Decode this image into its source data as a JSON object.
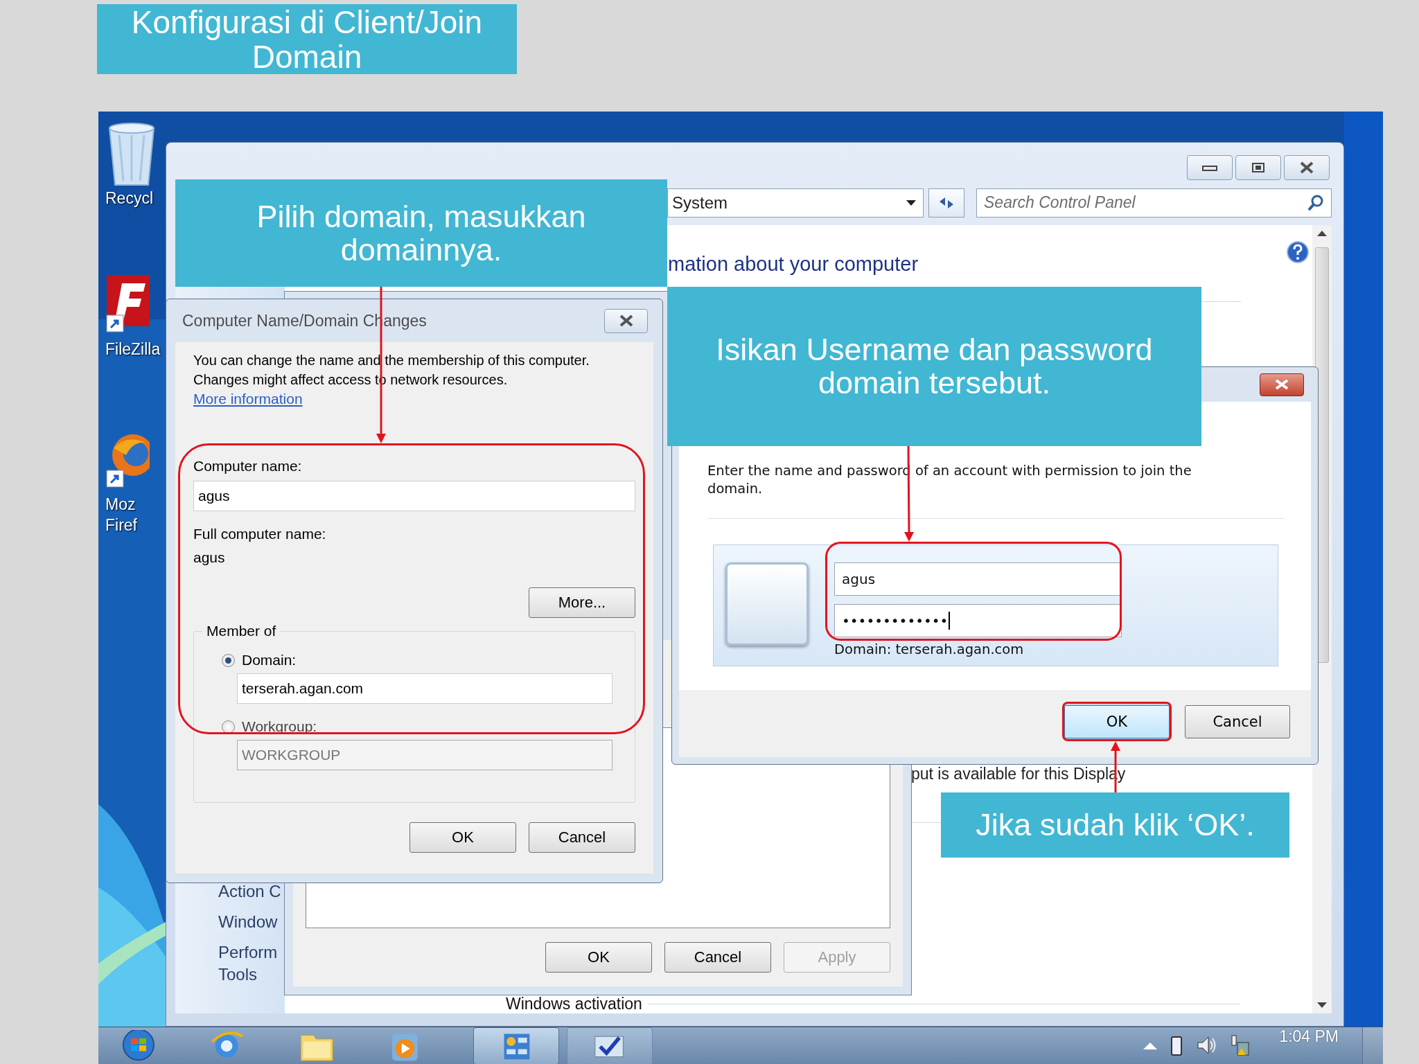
{
  "slide_title": "Konfigurasi di Client/Join Domain",
  "desktop_icons": [
    {
      "kind": "recycle-bin",
      "lines": [
        "Recycl"
      ]
    },
    {
      "kind": "filezilla",
      "lines": [
        "FileZilla"
      ]
    },
    {
      "kind": "firefox",
      "lines": [
        "Moz",
        "Firef"
      ]
    }
  ],
  "control_panel": {
    "address": "System",
    "search_placeholder": "Search Control Panel",
    "heading": "mation about your computer",
    "nav_links": [
      {
        "lines": [
          "Action C"
        ]
      },
      {
        "lines": [
          "Window"
        ]
      },
      {
        "lines": [
          "Perform",
          "Tools"
        ]
      }
    ],
    "detail_text": "put is available for this Display",
    "section_label": "Windows activation"
  },
  "system_properties": {
    "buttons": [
      {
        "label": "OK",
        "disabled": false
      },
      {
        "label": "Cancel",
        "disabled": false
      },
      {
        "label": "Apply",
        "disabled": true
      }
    ]
  },
  "name_dialog": {
    "title": "Computer Name/Domain Changes",
    "intro": "You can change the name and the membership of this computer. Changes might affect access to network resources.",
    "link": "More information",
    "computer_name_label": "Computer name:",
    "computer_name": "agus",
    "full_name_label": "Full computer name:",
    "full_name": "agus",
    "more_button": "More...",
    "member_of": "Member of",
    "options": [
      {
        "label": "Domain:",
        "selected": true,
        "value": "terserah.agan.com"
      },
      {
        "label": "Workgroup:",
        "selected": false,
        "value": "WORKGROUP"
      }
    ],
    "buttons": [
      "OK",
      "Cancel"
    ]
  },
  "credentials_dialog": {
    "instruction": "Enter the name and password of an account with permission to join the domain.",
    "username": "agus",
    "password": "•••••••••••••",
    "domain_note": "Domain: terserah.agan.com",
    "buttons": [
      {
        "label": "OK",
        "default": true
      },
      {
        "label": "Cancel",
        "default": false
      }
    ]
  },
  "callouts": [
    {
      "text": "Pilih domain, masukkan domainnya."
    },
    {
      "text": "Isikan Username dan password domain tersebut."
    },
    {
      "text": "Jika sudah klik ‘OK’."
    }
  ],
  "taskbar": {
    "buttons": [
      {
        "kind": "start",
        "selected": false
      },
      {
        "kind": "browser",
        "selected": false
      },
      {
        "kind": "folder",
        "selected": false
      },
      {
        "kind": "media",
        "selected": false
      },
      {
        "kind": "control-panel",
        "selected": true
      },
      {
        "kind": "monitor",
        "selected": false
      }
    ],
    "clock": "1:04 PM"
  }
}
